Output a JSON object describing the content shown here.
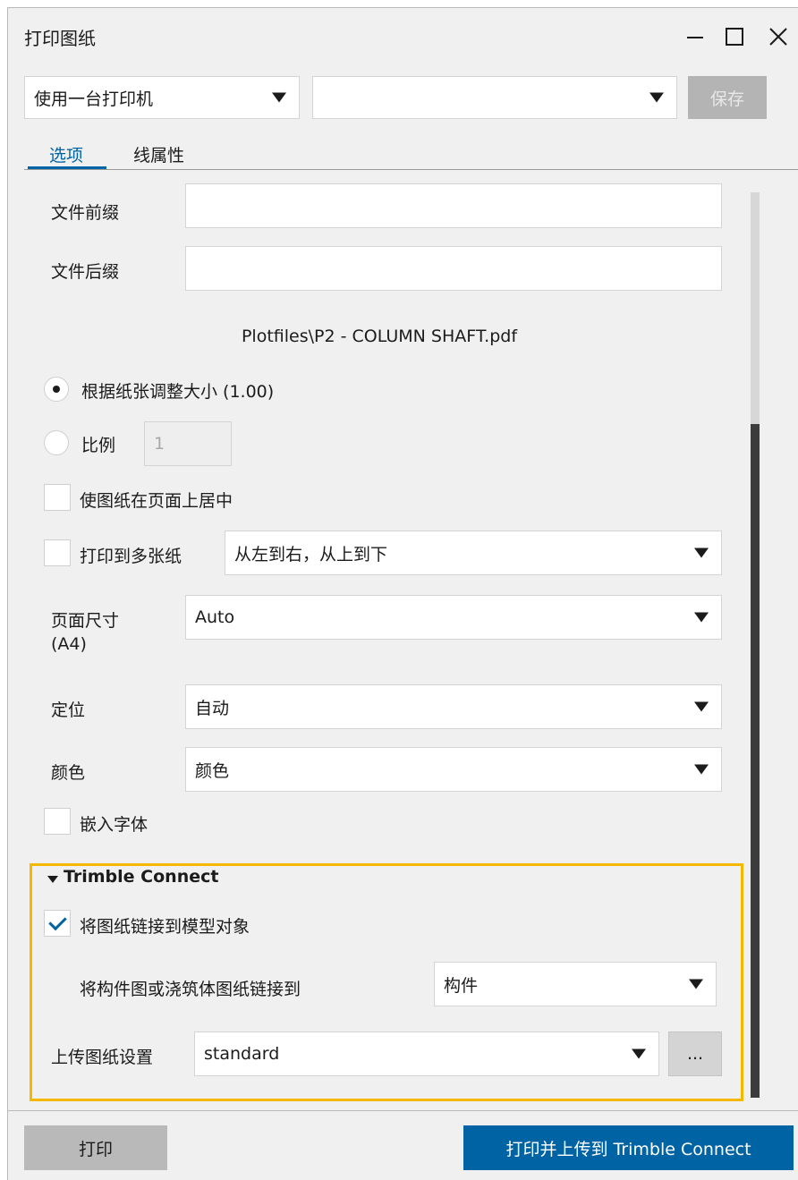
{
  "window": {
    "title": "打印图纸"
  },
  "toolbar": {
    "printer_select": "使用一台打印机",
    "settings_select": "",
    "save_label": "保存"
  },
  "tabs": [
    {
      "label": "选项"
    },
    {
      "label": "线属性"
    }
  ],
  "options": {
    "file_prefix_label": "文件前缀",
    "file_prefix_value": "",
    "file_suffix_label": "文件后缀",
    "file_suffix_value": "",
    "output_path": "Plotfiles\\P2 - COLUMN SHAFT.pdf",
    "fit_to_paper_label": "根据纸张调整大小 (1.00)",
    "scale_label": "比例",
    "scale_value": "1",
    "center_label": "使图纸在页面上居中",
    "multi_sheet_label": "打印到多张纸",
    "multi_sheet_order": "从左到右，从上到下",
    "page_size_label": "页面尺寸",
    "page_size_sub": "(A4)",
    "page_size_value": "Auto",
    "orientation_label": "定位",
    "orientation_value": "自动",
    "color_label": "颜色",
    "color_value": "颜色",
    "embed_fonts_label": "嵌入字体"
  },
  "trimble": {
    "section_title": "Trimble Connect",
    "link_drawing_label": "将图纸链接到模型对象",
    "link_to_label": "将构件图或浇筑体图纸链接到",
    "link_to_value": "构件",
    "upload_settings_label": "上传图纸设置",
    "upload_settings_value": "standard",
    "more_button": "..."
  },
  "footer": {
    "print_label": "打印",
    "print_upload_label": "打印并上传到 Trimble Connect"
  },
  "colors": {
    "accent": "#0063a3",
    "highlight_box": "#f5b800",
    "disabled": "#b4b4b4"
  }
}
